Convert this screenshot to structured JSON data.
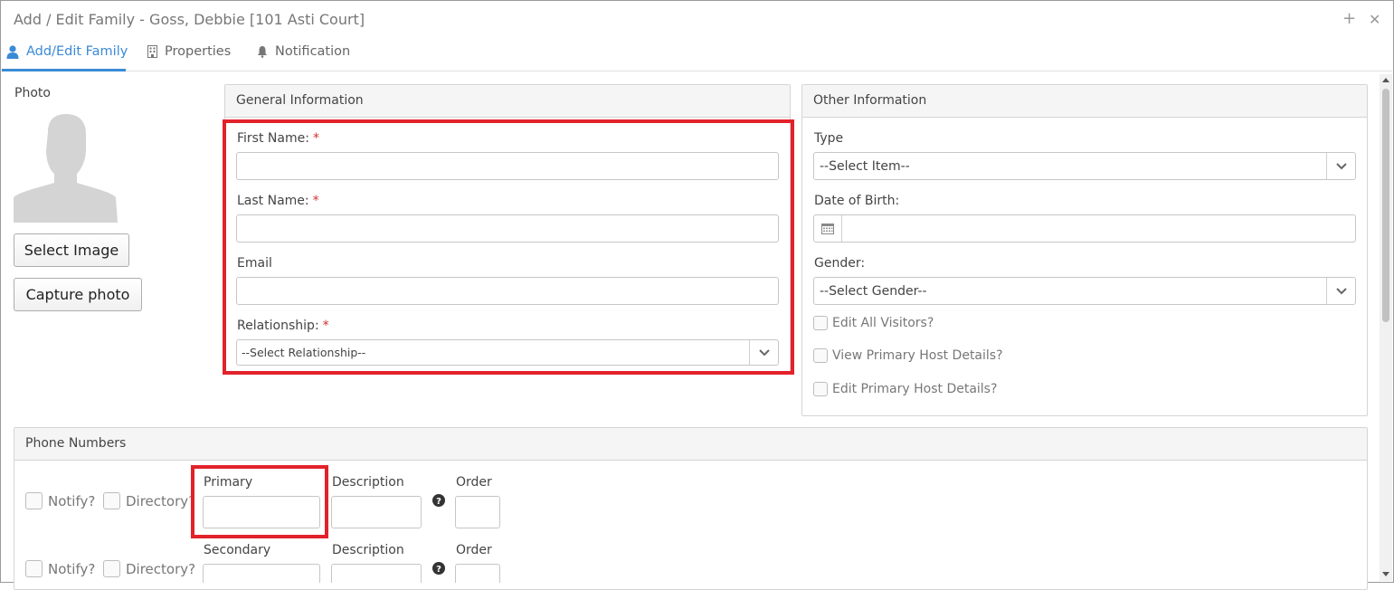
{
  "window": {
    "title": "Add / Edit Family - Goss, Debbie [101 Asti Court]",
    "maximize_glyph": "+",
    "close_glyph": "✕"
  },
  "tabs": [
    {
      "label": "Add/Edit Family",
      "icon": "user-icon",
      "active": true
    },
    {
      "label": "Properties",
      "icon": "building-icon",
      "active": false
    },
    {
      "label": "Notification",
      "icon": "bell-icon",
      "active": false
    }
  ],
  "photo": {
    "label": "Photo",
    "select_button": "Select Image",
    "capture_button": "Capture photo"
  },
  "general": {
    "header": "General Information",
    "first_name_label": "First Name:",
    "last_name_label": "Last Name:",
    "email_label": "Email",
    "relationship_label": "Relationship:",
    "relationship_value": "--Select Relationship--",
    "required_mark": "*"
  },
  "other": {
    "header": "Other Information",
    "type_label": "Type",
    "type_value": "--Select Item--",
    "dob_label": "Date of Birth:",
    "gender_label": "Gender:",
    "gender_value": "--Select Gender--",
    "edit_all_visitors": "Edit All Visitors?",
    "view_primary_host": "View Primary Host Details?",
    "edit_primary_host": "Edit Primary Host Details?"
  },
  "phones": {
    "header": "Phone Numbers",
    "rows": [
      {
        "notify": "Notify?",
        "directory": "Directory?",
        "number_label": "Primary",
        "description_label": "Description",
        "order_label": "Order"
      },
      {
        "notify": "Notify?",
        "directory": "Directory?",
        "number_label": "Secondary",
        "description_label": "Description",
        "order_label": "Order"
      }
    ]
  },
  "colors": {
    "accent": "#3a8ad6",
    "highlight": "#e2222b",
    "required": "#d0312d"
  }
}
